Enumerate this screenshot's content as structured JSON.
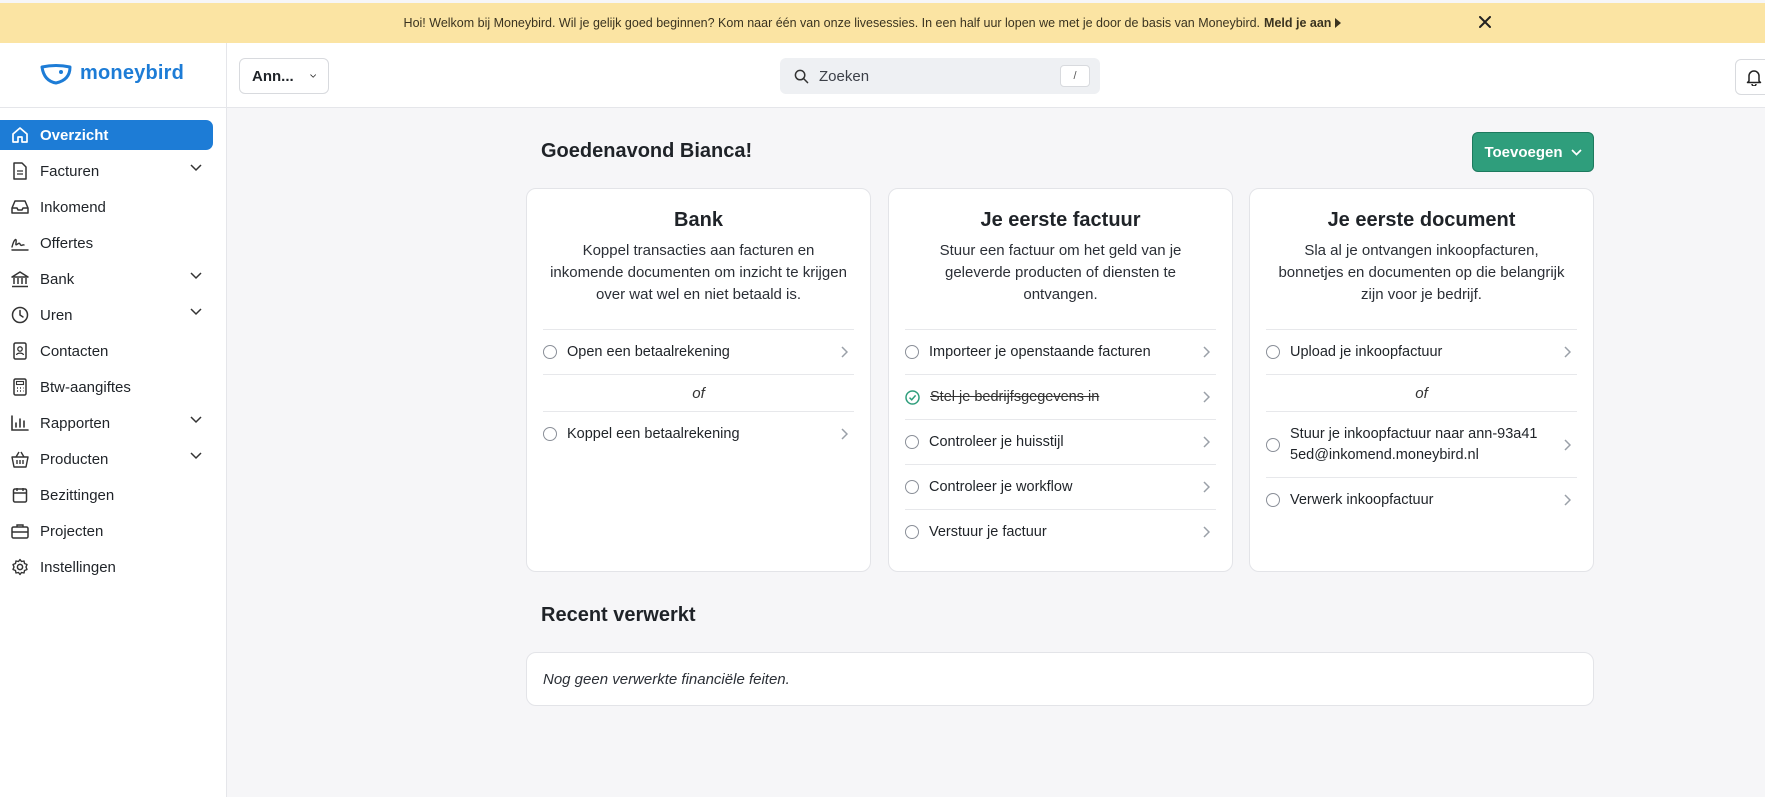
{
  "banner": {
    "message": "Hoi! Welkom bij Moneybird. Wil je gelijk goed beginnen? Kom naar één van onze livesessies. In een half uur lopen we met je door de basis van Moneybird.",
    "cta": "Meld je aan"
  },
  "header": {
    "logo_text": "moneybird",
    "administration": "Ann...",
    "search_placeholder": "Zoeken",
    "search_shortcut": "/"
  },
  "sidebar": {
    "items": [
      {
        "label": "Overzicht",
        "icon": "home-icon",
        "active": true
      },
      {
        "label": "Facturen",
        "icon": "document-icon",
        "expandable": true
      },
      {
        "label": "Inkomend",
        "icon": "inbox-icon"
      },
      {
        "label": "Offertes",
        "icon": "signature-icon"
      },
      {
        "label": "Bank",
        "icon": "bank-icon",
        "expandable": true
      },
      {
        "label": "Uren",
        "icon": "clock-icon",
        "expandable": true
      },
      {
        "label": "Contacten",
        "icon": "contact-card-icon"
      },
      {
        "label": "Btw-aangiftes",
        "icon": "calculator-icon"
      },
      {
        "label": "Rapporten",
        "icon": "bar-chart-icon",
        "expandable": true
      },
      {
        "label": "Producten",
        "icon": "basket-icon",
        "expandable": true
      },
      {
        "label": "Bezittingen",
        "icon": "box-icon"
      },
      {
        "label": "Projecten",
        "icon": "briefcase-icon"
      },
      {
        "label": "Instellingen",
        "icon": "gear-icon"
      }
    ]
  },
  "main": {
    "greeting": "Goedenavond Bianca!",
    "add_button": "Toevoegen",
    "cards": [
      {
        "title": "Bank",
        "description": "Koppel transacties aan facturen en inkomende documenten om inzicht te krijgen over wat wel en niet betaald is.",
        "tasks": [
          "Open een betaalrekening",
          "Koppel een betaalrekening"
        ],
        "separator": "of"
      },
      {
        "title": "Je eerste factuur",
        "description": "Stuur een factuur om het geld van je geleverde producten of diensten te ontvangen.",
        "tasks": [
          "Importeer je openstaande facturen",
          "Stel je bedrijfsgegevens in",
          "Controleer je huisstijl",
          "Controleer je workflow",
          "Verstuur je factuur"
        ]
      },
      {
        "title": "Je eerste document",
        "description": "Sla al je ontvangen inkoopfacturen, bonnetjes en documenten op die belangrijk zijn voor je bedrijf.",
        "tasks": [
          "Upload je inkoopfactuur",
          "Stuur je inkoopfactuur naar ann-93a41\n5ed@inkomend.moneybird.nl",
          "Verwerk inkoopfactuur"
        ],
        "separator": "of"
      }
    ],
    "recent_title": "Recent verwerkt",
    "recent_empty": "Nog geen verwerkte financiële feiten."
  },
  "colors": {
    "brand_blue": "#1d7cd6",
    "banner_bg": "#fbe4a3",
    "add_button_green": "#2f9e7c",
    "done_check": "#2f9e7c"
  }
}
